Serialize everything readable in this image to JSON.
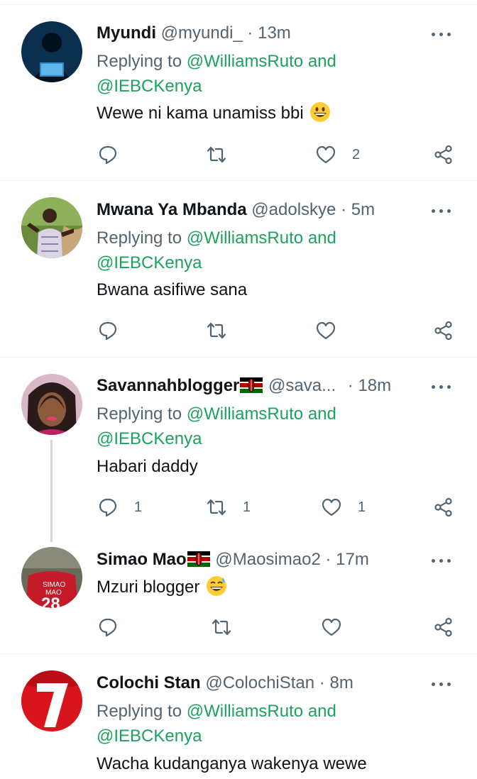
{
  "reply_prefix": "Replying to",
  "tweets": [
    {
      "name": "Myundi",
      "handle": "@myundi_",
      "time": "13m",
      "reply_to": [
        "@WilliamsRuto",
        "and",
        "@IEBCKenya"
      ],
      "text": "Wewe ni kama unamiss bbi",
      "emoji": "grinning-face",
      "counts": {
        "reply": "",
        "retweet": "",
        "like": "2"
      }
    },
    {
      "name": "Mwana Ya Mbanda",
      "handle": "@adolskye",
      "time": "5m",
      "reply_to": [
        "@WilliamsRuto",
        "and",
        "@IEBCKenya"
      ],
      "text": "Bwana asifiwe sana",
      "counts": {
        "reply": "",
        "retweet": "",
        "like": ""
      }
    },
    {
      "name": "Savannahblogger",
      "flag": "kenya-flag",
      "handle": "@sava...",
      "time": "18m",
      "reply_to": [
        "@WilliamsRuto",
        "and",
        "@IEBCKenya"
      ],
      "text": "Habari daddy",
      "counts": {
        "reply": "1",
        "retweet": "1",
        "like": "1"
      }
    },
    {
      "name": "Simao Mao",
      "flag": "kenya-flag",
      "handle": "@Maosimao2",
      "time": "17m",
      "text": "Mzuri blogger",
      "emoji": "grinning-sweat-face",
      "counts": {
        "reply": "",
        "retweet": "",
        "like": ""
      }
    },
    {
      "name": "Colochi Stan",
      "handle": "@ColochiStan",
      "time": "8m",
      "reply_to": [
        "@WilliamsRuto",
        "and",
        "@IEBCKenya"
      ],
      "text": "Wacha kudanganya wakenya wewe"
    }
  ],
  "colors": {
    "mention": "#1da15e",
    "secondary": "#536471",
    "divider": "#eff3f4"
  },
  "icons": [
    "reply-icon",
    "retweet-icon",
    "like-icon",
    "share-icon",
    "more-icon"
  ]
}
